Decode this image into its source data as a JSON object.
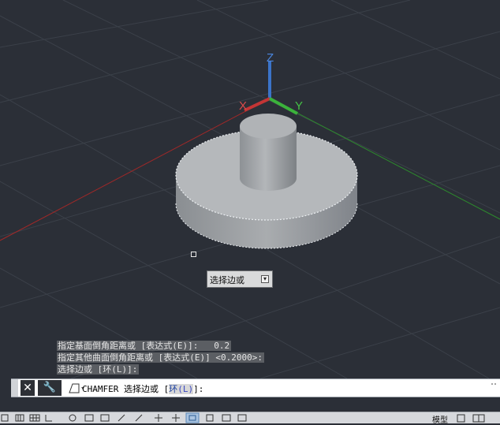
{
  "viewport": {
    "axes": {
      "z_label": "Z",
      "x_label": "X",
      "y_label": "Y"
    },
    "colors": {
      "background": "#2b2f37",
      "grid": "#3b4049",
      "x_axis": "#c33535",
      "y_axis": "#3bb23b",
      "z_axis": "#3b74c9",
      "solid": "#a9acaf"
    }
  },
  "tooltip": {
    "text": "选择边或",
    "dropdown_icon": "arrow-down-icon"
  },
  "history": {
    "lines": [
      "指定基面倒角距离或 [表达式(E)]:   0.2",
      "指定其他曲面倒角距离或 [表达式(E)] <0.2000>:",
      "选择边或 [环(L)]:"
    ]
  },
  "command_line": {
    "command": "CHAMFER",
    "prompt": "选择边或",
    "bracket_open": "[",
    "option": "环",
    "option_key": "(L)",
    "bracket_close": "]:"
  },
  "statusbar": {
    "model_tab": "模型"
  }
}
